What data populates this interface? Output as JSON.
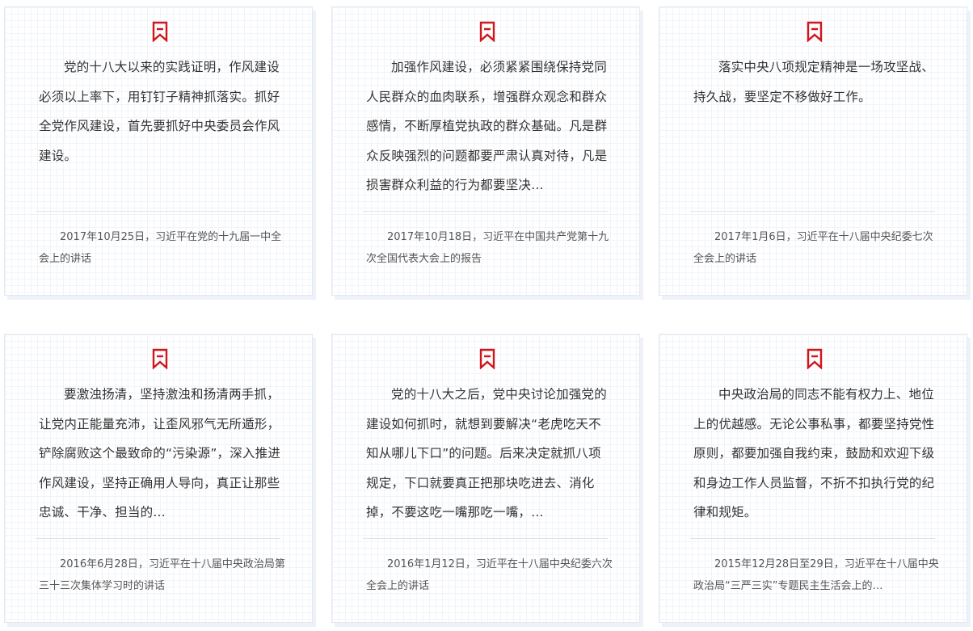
{
  "accent_color": "#d0151b",
  "icon": "bookmark-icon",
  "cards": [
    {
      "quote": "党的十八大以来的实践证明，作风建设必须以上率下，用钉钉子精神抓落实。抓好全党作风建设，首先要抓好中央委员会作风建设。",
      "source": "2017年10月25日，习近平在党的十九届一中全会上的讲话"
    },
    {
      "quote": "加强作风建设，必须紧紧围绕保持党同人民群众的血肉联系，增强群众观念和群众感情，不断厚植党执政的群众基础。凡是群众反映强烈的问题都要严肃认真对待，凡是损害群众利益的行为都要坚决…",
      "source": "2017年10月18日，习近平在中国共产党第十九次全国代表大会上的报告"
    },
    {
      "quote": "落实中央八项规定精神是一场攻坚战、持久战，要坚定不移做好工作。",
      "source": "2017年1月6日，习近平在十八届中央纪委七次全会上的讲话"
    },
    {
      "quote": "要激浊扬清，坚持激浊和扬清两手抓，让党内正能量充沛，让歪风邪气无所遁形，铲除腐败这个最致命的“污染源”，深入推进作风建设，坚持正确用人导向，真正让那些忠诚、干净、担当的…",
      "source": "2016年6月28日，习近平在十八届中央政治局第三十三次集体学习时的讲话"
    },
    {
      "quote": "党的十八大之后，党中央讨论加强党的建设如何抓时，就想到要解决“老虎吃天不知从哪儿下口”的问题。后来决定就抓八项规定，下口就要真正把那块吃进去、消化掉，不要这吃一嘴那吃一嘴，…",
      "source": "2016年1月12日，习近平在十八届中央纪委六次全会上的讲话"
    },
    {
      "quote": "中央政治局的同志不能有权力上、地位上的优越感。无论公事私事，都要坚持党性原则，都要加强自我约束，鼓励和欢迎下级和身边工作人员监督，不折不扣执行党的纪律和规矩。",
      "source": "2015年12月28日至29日，习近平在十八届中央政治局“三严三实”专题民主生活会上的…"
    }
  ]
}
